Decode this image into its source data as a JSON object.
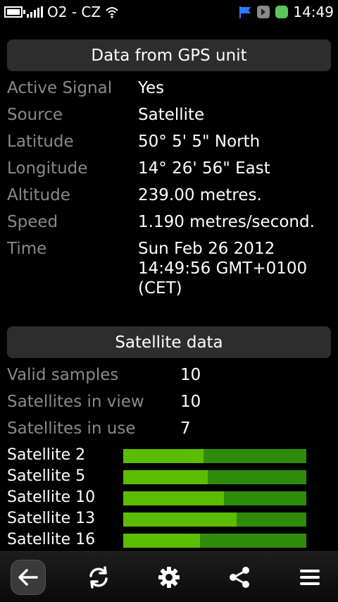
{
  "status_bar": {
    "carrier": "O2 - CZ",
    "time": "14:49"
  },
  "gps": {
    "header": "Data from GPS unit",
    "rows": [
      {
        "label": "Active Signal",
        "value": "Yes"
      },
      {
        "label": "Source",
        "value": "Satellite"
      },
      {
        "label": "Latitude",
        "value": "50° 5' 5\" North"
      },
      {
        "label": "Longitude",
        "value": "14° 26' 56\" East"
      },
      {
        "label": "Altitude",
        "value": "239.00 metres."
      },
      {
        "label": "Speed",
        "value": "1.190 metres/second."
      },
      {
        "label": "Time",
        "value_lines": [
          "Sun Feb 26 2012",
          "14:49:56 GMT+0100",
          "(CET)"
        ]
      }
    ]
  },
  "satellite_data": {
    "header": "Satellite data",
    "rows": [
      {
        "label": "Valid samples",
        "value": "10"
      },
      {
        "label": "Satellites in view",
        "value": "10"
      },
      {
        "label": "Satellites in use",
        "value": "7"
      }
    ],
    "satellites": [
      {
        "name": "Satellite 2",
        "signal": 0.44
      },
      {
        "name": "Satellite 5",
        "signal": 0.46
      },
      {
        "name": "Satellite 10",
        "signal": 0.55
      },
      {
        "name": "Satellite 13",
        "signal": 0.62
      },
      {
        "name": "Satellite 16",
        "signal": 0.42
      }
    ],
    "bar_colors": {
      "fill": "#5cbc00",
      "track": "#2e8c0a"
    }
  },
  "toolbar": {
    "icons": [
      "back-arrow-icon",
      "refresh-icon",
      "gear-icon",
      "share-icon",
      "menu-icon"
    ]
  }
}
